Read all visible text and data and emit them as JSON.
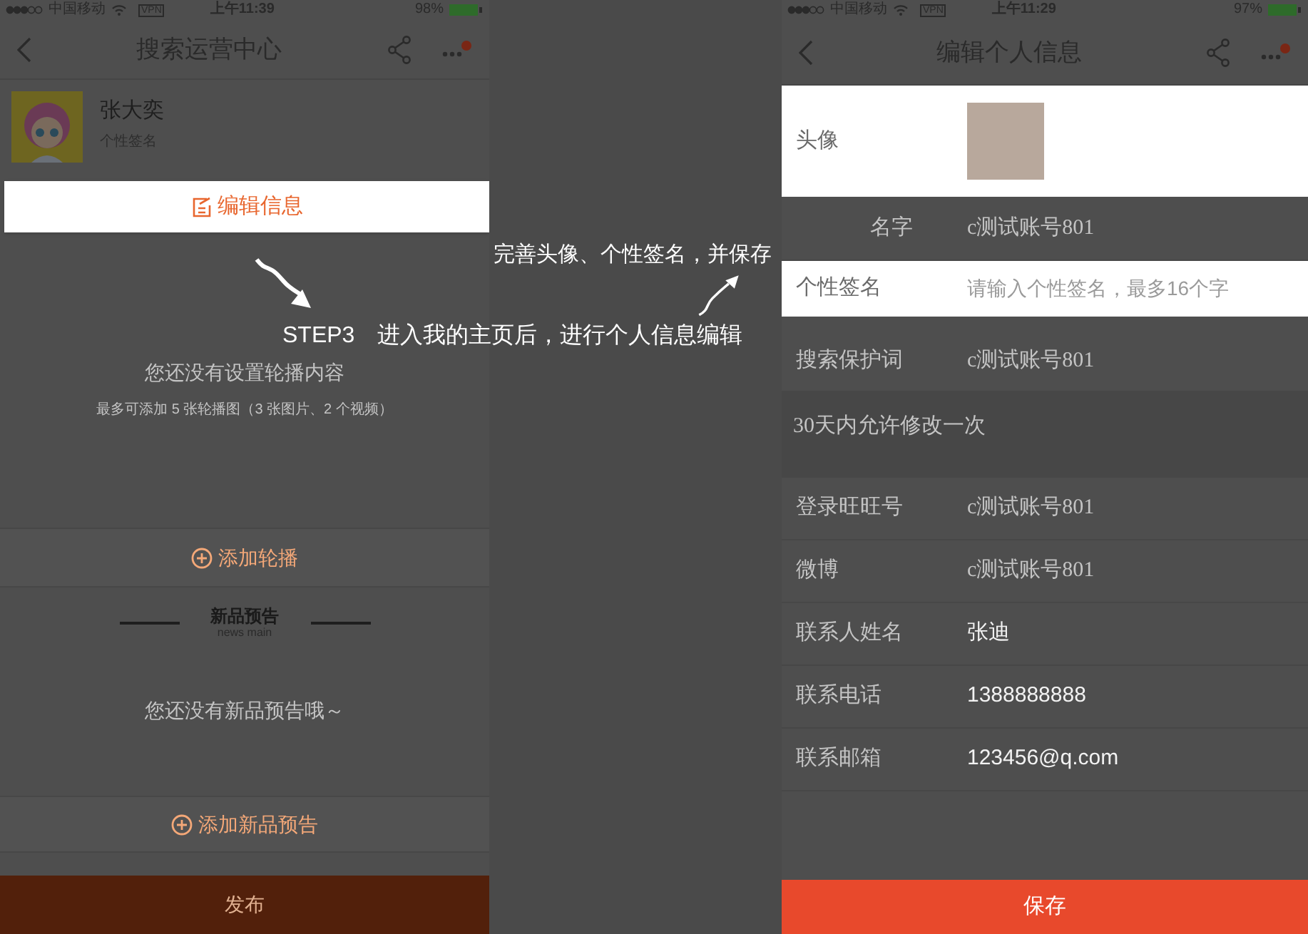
{
  "captions": [
    {
      "text": "完善头像、个性签名，并保存"
    },
    {
      "text": "STEP3　进入我的主页后，进行个人信息编辑"
    }
  ],
  "left": {
    "status": {
      "carrier": "中国移动",
      "vpn": "VPN",
      "time": "上午11:39",
      "battery": "98%"
    },
    "title": "搜索运营中心",
    "profile": {
      "name": "张大奕",
      "signature": "个性签名"
    },
    "edit_button": "编辑信息",
    "carousel": {
      "empty": "您还没有设置轮播内容",
      "hint": "最多可添加 5 张轮播图（3 张图片、2 个视频）",
      "add_button": "添加轮播"
    },
    "news": {
      "title": "新品预告",
      "subtitle": "news main",
      "empty": "您还没有新品预告哦～",
      "add_button": "添加新品预告"
    },
    "publish_button": "发布"
  },
  "right": {
    "status": {
      "carrier": "中国移动",
      "vpn": "VPN",
      "time": "上午11:29",
      "battery": "97%"
    },
    "title": "编辑个人信息",
    "fields": [
      {
        "kind": "avatar",
        "label": "头像",
        "highlighted": true
      },
      {
        "kind": "readonly",
        "label": "名字",
        "value": "c测试账号801",
        "highlighted": false
      },
      {
        "kind": "input",
        "label": "个性签名",
        "placeholder": "请输入个性签名，最多16个字",
        "highlighted": true
      },
      {
        "kind": "readonly",
        "label": "搜索保护词",
        "value": "c测试账号801",
        "highlighted": false
      },
      {
        "kind": "note",
        "value": "30天内允许修改一次",
        "highlighted": false
      },
      {
        "kind": "readonly",
        "label": "登录旺旺号",
        "value": "c测试账号801",
        "highlighted": false
      },
      {
        "kind": "readonly",
        "label": "微博",
        "value": "c测试账号801",
        "highlighted": false
      },
      {
        "kind": "text",
        "label": "联系人姓名",
        "value": "张迪",
        "highlighted": false
      },
      {
        "kind": "text",
        "label": "联系电话",
        "value": "1388888888",
        "highlighted": false
      },
      {
        "kind": "text",
        "label": "联系邮箱",
        "value": "123456@q.com",
        "highlighted": false
      }
    ],
    "save_button": "保存"
  }
}
